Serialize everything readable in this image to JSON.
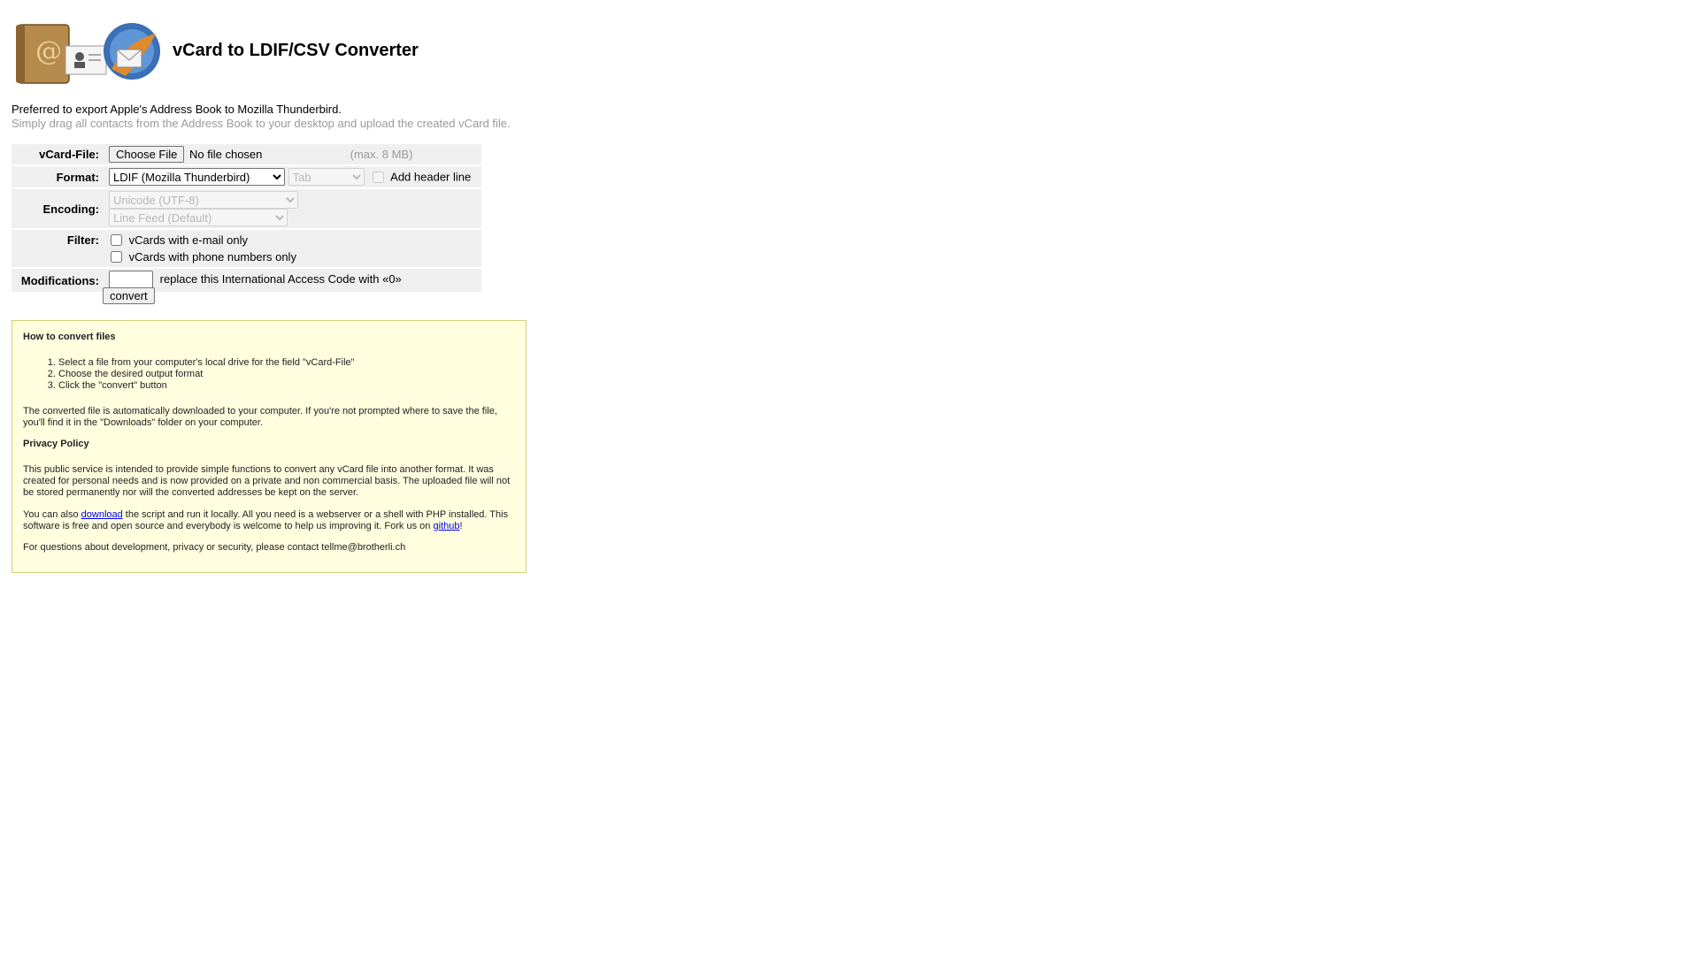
{
  "title": "vCard to LDIF/CSV Converter",
  "intro": {
    "line1": "Preferred to export Apple's Address Book to Mozilla Thunderbird.",
    "line2": "Simply drag all contacts from the Address Book to your desktop and upload the created vCard file."
  },
  "form": {
    "vcard_label": "vCard-File:",
    "choose_file": "Choose File",
    "no_file": "No file chosen",
    "max_size": "(max. 8 MB)",
    "format_label": "Format:",
    "format_selected": "LDIF (Mozilla Thunderbird)",
    "delimiter_selected": "Tab",
    "header_line_label": "Add header line",
    "encoding_label": "Encoding:",
    "encoding_selected": "Unicode (UTF-8)",
    "linefeed_selected": "Line Feed (Default)",
    "filter_label": "Filter:",
    "filter_email": "vCards with e-mail only",
    "filter_phone": "vCards with phone numbers only",
    "mod_label": "Modifications:",
    "mod_text": "replace this International Access Code with «0»",
    "convert": "convert"
  },
  "info": {
    "howto_title": "How to convert files",
    "steps": [
      "Select a file from your computer's local drive for the field \"vCard-File\"",
      "Choose the desired output format",
      "Click the \"convert\" button"
    ],
    "download_note": "The converted file is automatically downloaded to your computer. If you're not prompted where to save the file, you'll find it in the \"Downloads\" folder on your computer.",
    "privacy_title": "Privacy Policy",
    "privacy_text": "This public service is intended to provide simple functions to convert any vCard file into another format. It was created for personal needs and is now provided on a private and non commercial basis. The uploaded file will not be stored permanently nor will the converted addresses be kept on the server.",
    "also_pre": "You can also ",
    "download_link": "download",
    "also_mid": " the script and run it locally. All you need is a webserver or a shell with PHP installed. This software is free and open source and everybody is welcome to help us improving it. Fork us on ",
    "github_link": "github",
    "also_post": "!",
    "contact": "For questions about development, privacy or security, please contact tellme@brotherli.ch"
  },
  "colors": {
    "info_bg": "#ffffe0",
    "info_border": "#cfcf7a",
    "row_bg": "#efefef",
    "hint": "#9a9a9a"
  }
}
